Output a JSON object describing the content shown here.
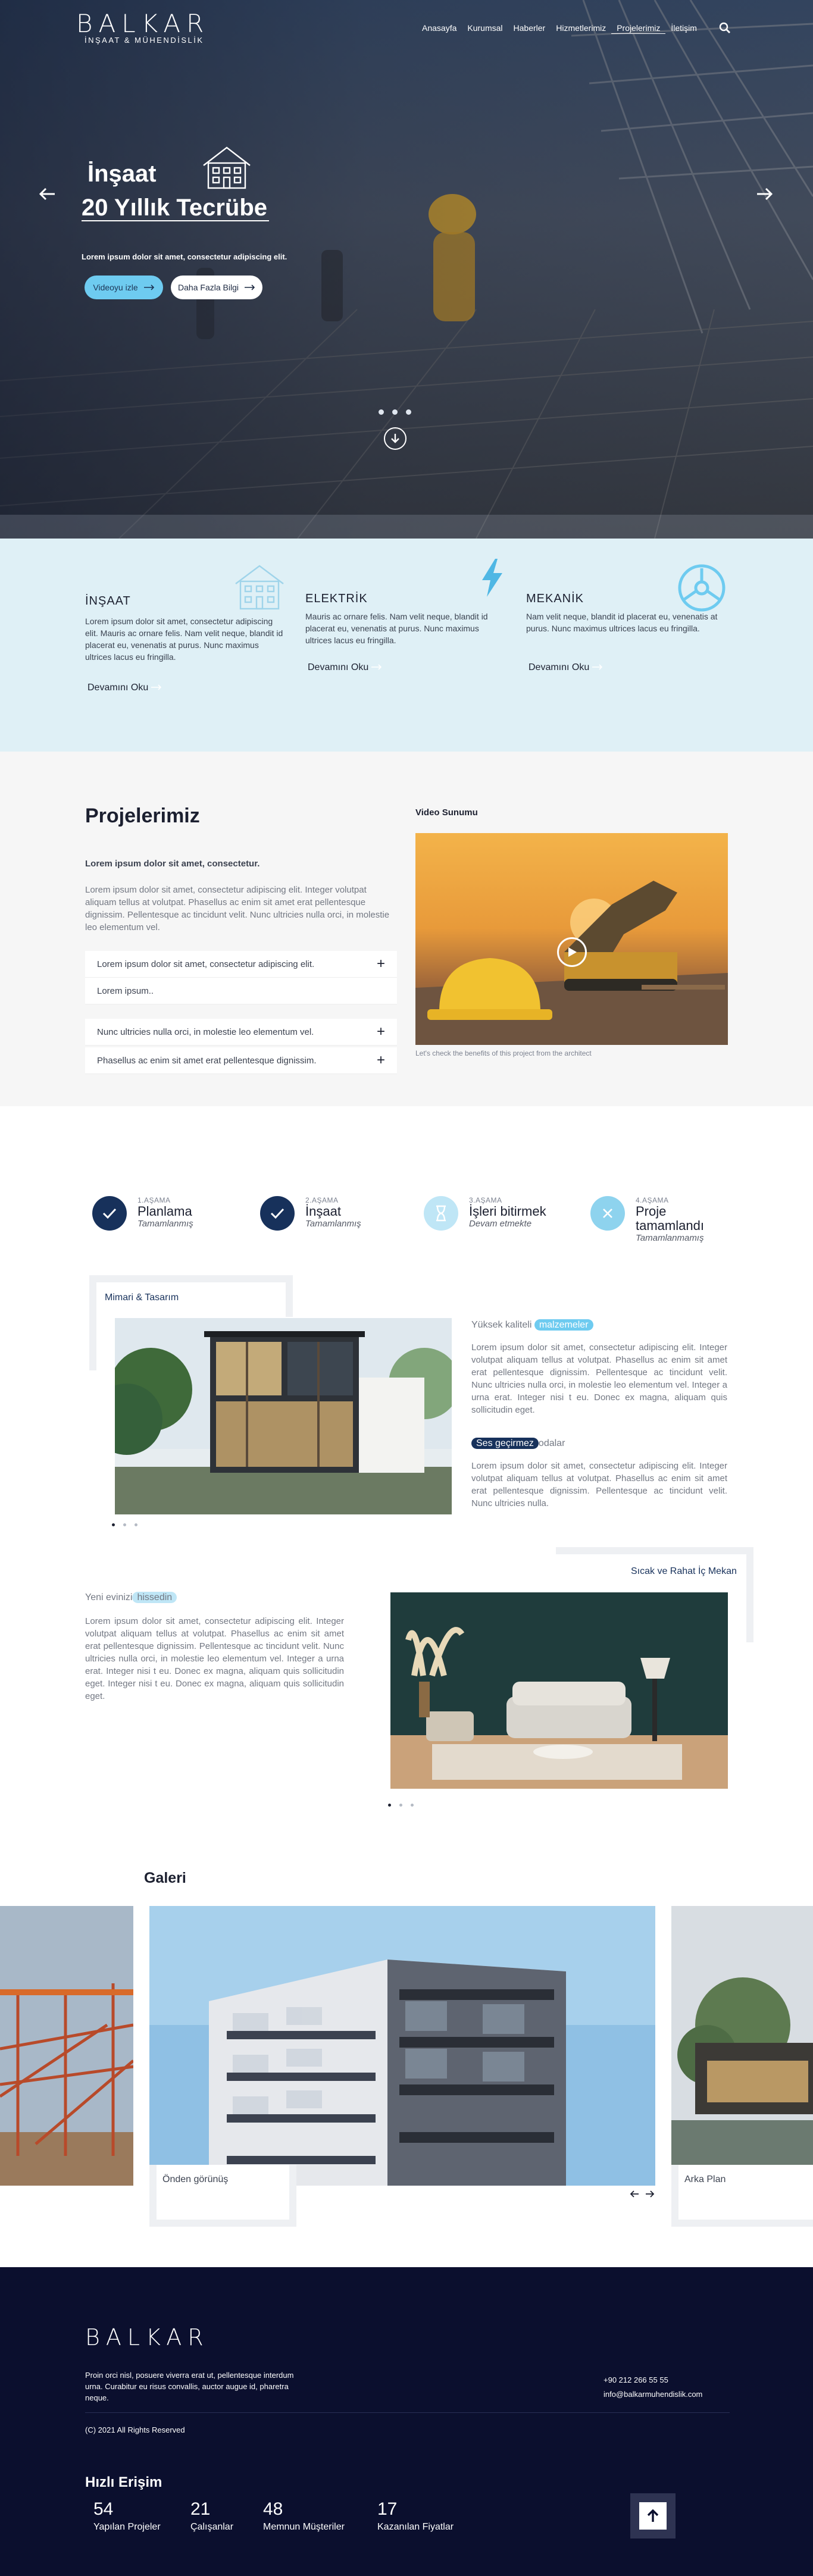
{
  "header": {
    "logo_text": "BALKAR",
    "logo_sub": "İNŞAAT & MÜHENDİSLİK",
    "nav": [
      "Anasayfa",
      "Kurumsal",
      "Haberler",
      "Hizmetlerimiz",
      "Projelerimiz",
      "İletişim"
    ],
    "active_nav": "Projelerimiz"
  },
  "hero": {
    "title_1": "İnşaat",
    "title_2": "20 Yıllık Tecrübe",
    "text": "Lorem ipsum dolor sit amet, consectetur adipiscing elit.",
    "btn_video": "Videoyu izle",
    "btn_more": "Daha Fazla Bilgi"
  },
  "services": [
    {
      "title": "İNŞAAT",
      "text": "Lorem ipsum dolor sit amet, consectetur adipiscing elit. Mauris ac ornare felis. Nam velit neque, blandit id placerat eu, venenatis at purus. Nunc maximus ultrices lacus eu fringilla.",
      "button": "Devamını Oku",
      "icon": "building-icon"
    },
    {
      "title": "ELEKTRİK",
      "text": "Mauris ac ornare felis. Nam velit neque, blandit id placerat eu, venenatis at purus. Nunc maximus ultrices lacus eu fringilla.",
      "button": "Devamını Oku",
      "icon": "lightning-icon"
    },
    {
      "title": "MEKANİK",
      "text": "Nam velit neque, blandit id placerat eu, venenatis at purus. Nunc maximus ultrices lacus eu fringilla.",
      "button": "Devamını Oku",
      "icon": "wheel-icon"
    }
  ],
  "projects": {
    "title": "Projelerimiz",
    "subtitle": "Lorem ipsum dolor sit amet, consectetur.",
    "text": "Lorem ipsum dolor sit amet, consectetur adipiscing elit. Integer volutpat aliquam tellus at volutpat. Phasellus ac enim sit amet erat pellentesque dignissim. Pellentesque ac tincidunt velit. Nunc ultricies nulla orci, in molestie leo elementum vel.",
    "accordion": [
      "Lorem ipsum dolor sit amet, consectetur adipiscing elit.",
      "Lorem ipsum..",
      "Nunc ultricies nulla orci, in molestie leo elementum vel.",
      "Phasellus ac enim sit amet erat pellentesque dignissim."
    ],
    "video_label": "Video Sunumu",
    "video_caption": "Let's check the benefits of this project from the architect"
  },
  "steps": [
    {
      "no": "1.AŞAMA",
      "name": "Planlama",
      "status": "Tamamlanmış",
      "state": "done"
    },
    {
      "no": "2.AŞAMA",
      "name": "İnşaat",
      "status": "Tamamlanmış",
      "state": "done"
    },
    {
      "no": "3.AŞAMA",
      "name": "İşleri bitirmek",
      "status": "Devam etmekte",
      "state": "progress"
    },
    {
      "no": "4.AŞAMA",
      "name": "Proje tamamlandı",
      "status": "Tamamlanmamış",
      "state": "todo"
    }
  ],
  "arch": {
    "label": "Mimari & Tasarım",
    "title_a": "Yüksek kaliteli",
    "title_a_hl": "malzemeler",
    "text_a": "Lorem ipsum dolor sit amet, consectetur adipiscing elit. Integer volutpat aliquam tellus at volutpat. Phasellus ac enim sit amet erat pellentesque dignissim. Pellentesque ac tincidunt velit. Nunc ultricies nulla orci, in molestie leo elementum vel. Integer a urna erat. Integer nisi t eu. Donec ex magna, aliquam quis sollicitudin eget.",
    "title_b_hl": "Ses geçirmez",
    "title_b": "odalar",
    "text_b": "Lorem ipsum dolor sit amet, consectetur adipiscing elit. Integer volutpat aliquam tellus at volutpat. Phasellus ac enim sit amet erat pellentesque dignissim. Pellentesque ac tincidunt velit. Nunc ultricies nulla."
  },
  "interior": {
    "label": "Sıcak ve Rahat İç Mekan",
    "title": "Yeni evinizi",
    "title_hl": "hissedin",
    "text": "Lorem ipsum dolor sit amet, consectetur adipiscing elit. Integer volutpat aliquam tellus at volutpat. Phasellus ac enim sit amet erat pellentesque dignissim. Pellentesque ac tincidunt velit. Nunc ultricies nulla orci, in molestie leo elementum vel. Integer a urna erat. Integer nisi t eu. Donec ex magna, aliquam quis sollicitudin eget. Integer nisi t eu. Donec ex magna, aliquam quis sollicitudin eget."
  },
  "gallery": {
    "title": "Galeri",
    "items": [
      "Önden görünüş",
      "Arka Plan"
    ]
  },
  "footer": {
    "logo_text": "BALKAR",
    "text": "Proin orci nisl, posuere viverra erat ut, pellentesque interdum urna. Curabitur eu risus convallis, auctor augue id, pharetra neque.",
    "phone": "+90 212 266 55 55",
    "email": "info@balkarmuhendislik.com",
    "copyright": "(C) 2021 All Rights Reserved",
    "quick_title": "Hızlı Erişim",
    "stats": [
      {
        "value": "54",
        "label": "Yapılan Projeler"
      },
      {
        "value": "21",
        "label": "Çalışanlar"
      },
      {
        "value": "48",
        "label": "Memnun Müşteriler"
      },
      {
        "value": "17",
        "label": "Kazanılan Fiyatlar"
      }
    ]
  },
  "colors": {
    "navy": "#17315b",
    "accent": "#6ecbf0",
    "footer": "#0b0f2e",
    "light_blue_bg": "#dff0f6"
  }
}
